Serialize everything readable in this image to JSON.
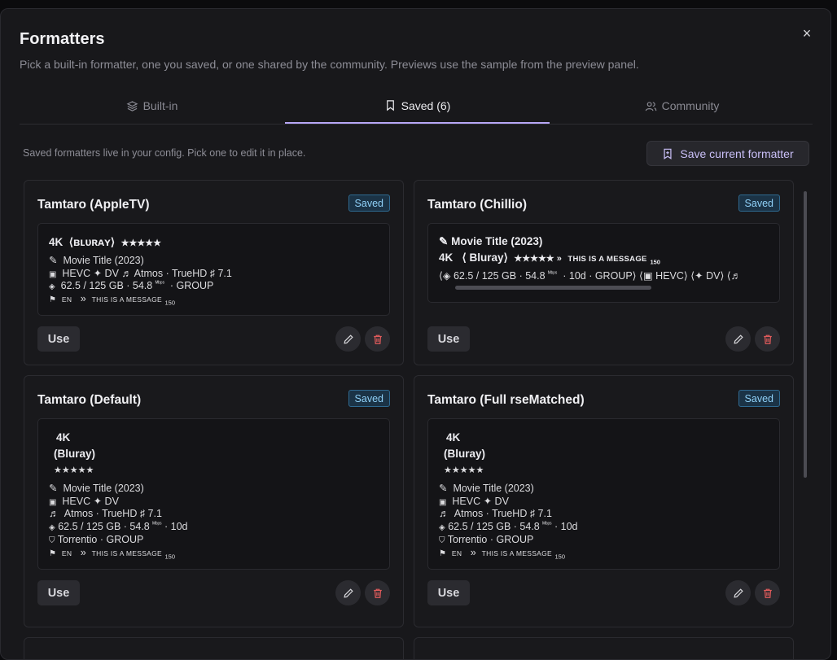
{
  "modal": {
    "title": "Formatters",
    "subtitle": "Pick a built-in formatter, one you saved, or one shared by the community. Previews use the sample from the preview panel.",
    "close_icon": "×"
  },
  "tabs": [
    {
      "label": "Built-in",
      "icon": "layers-icon",
      "active": false
    },
    {
      "label": "Saved (6)",
      "icon": "bookmark-icon",
      "active": true
    },
    {
      "label": "Community",
      "icon": "users-icon",
      "active": false
    }
  ],
  "saved": {
    "hint": "Saved formatters live in your config. Pick one to edit it in place.",
    "save_current_label": "Save current formatter"
  },
  "colors": {
    "accent": "#b7a6f5",
    "badge_text": "#8fd0f7",
    "badge_bg": "#1b3346",
    "danger": "#e05b5b"
  },
  "cards": [
    {
      "title": "Tamtaro (AppleTV)",
      "badge": "Saved",
      "use_label": "Use",
      "preview": {
        "l1a": "4K",
        "l1b": "⟨ʙʟᴜʀᴀʏ⟩",
        "l1c": "★★★★★",
        "l2": "Movie Title (2023)",
        "l3": "HEVC  ✦ DV ♬ Atmos · TrueHD  ♯ 7.1",
        "l4a": "62.5 / 125 GB · 54.8",
        "l4b": "ᴹᵇᵖˢ",
        "l4c": "· GROUP",
        "l5a": "EN",
        "l5b": "»",
        "l5c": "THIS IS A MESSAGE",
        "l5d": "150"
      }
    },
    {
      "title": "Tamtaro (Chillio)",
      "badge": "Saved",
      "use_label": "Use",
      "preview": {
        "l1": "Movie Title (2023)",
        "l2a": "4K",
        "l2b": "⟨ Bluray⟩",
        "l2c": "★★★★★ »",
        "l2d": "THIS IS A MESSAGE",
        "l2e": "150",
        "l3a": "⟨◈ 62.5 / 125 GB · 54.8",
        "l3b": "ᴹᵇᵖˢ",
        "l3c": "· 10d · GROUP⟩  ⟨▣ HEVC⟩  ⟨✦ DV⟩  ⟨♬"
      }
    },
    {
      "title": "Tamtaro (Default)",
      "badge": "Saved",
      "use_label": "Use",
      "preview": {
        "l1": "4K",
        "l2": "(Bluray)",
        "l3": "★★★★★",
        "l4": "Movie Title (2023)",
        "l5": "HEVC  ✦ DV",
        "l6": "Atmos · TrueHD  ♯ 7.1",
        "l7a": "62.5 / 125 GB · 54.8",
        "l7b": "ᴹᵇᵖˢ",
        "l7c": "· 10d",
        "l8": "Torrentio · GROUP",
        "l9a": "EN",
        "l9b": "»",
        "l9c": "THIS IS A MESSAGE",
        "l9d": "150"
      }
    },
    {
      "title": "Tamtaro (Full rseMatched)",
      "badge": "Saved",
      "use_label": "Use",
      "preview": {
        "l1": "4K",
        "l2": "(Bluray)",
        "l3": "★★★★★",
        "l4": "Movie Title (2023)",
        "l5": "HEVC  ✦ DV",
        "l6": "Atmos · TrueHD  ♯ 7.1",
        "l7a": "62.5 / 125 GB · 54.8",
        "l7b": "ᴹᵇᵖˢ",
        "l7c": "· 10d",
        "l8": "Torrentio · GROUP",
        "l9a": "EN",
        "l9b": "»",
        "l9c": "THIS IS A MESSAGE",
        "l9d": "150"
      }
    }
  ]
}
